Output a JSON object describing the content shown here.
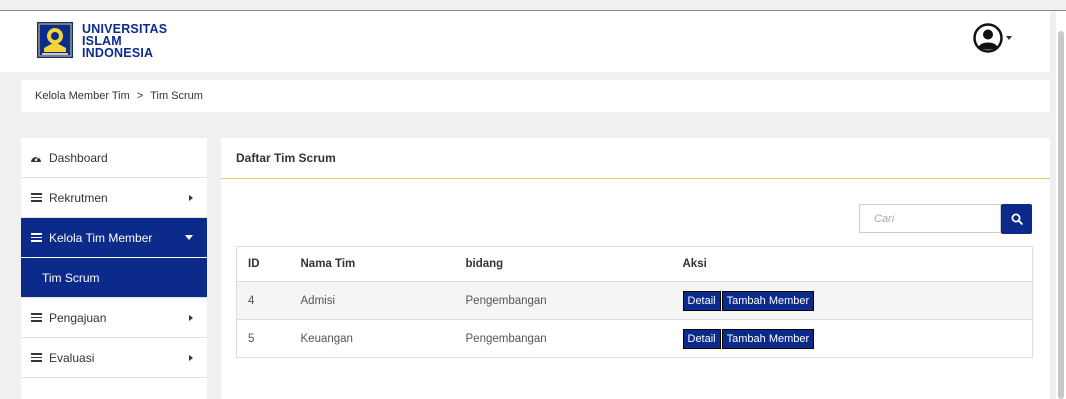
{
  "header": {
    "logo_line1": "UNIVERSITAS",
    "logo_line2": "ISLAM",
    "logo_line3": "INDONESIA"
  },
  "breadcrumb": {
    "parent": "Kelola Member Tim",
    "separator": ">",
    "current": "Tim Scrum"
  },
  "sidebar": {
    "items": [
      {
        "label": "Dashboard",
        "icon": "tachometer-icon"
      },
      {
        "label": "Rekrutmen",
        "icon": "list-icon"
      },
      {
        "label": "Kelola Tim Member",
        "icon": "list-icon"
      },
      {
        "label": "Tim Scrum"
      },
      {
        "label": "Pengajuan",
        "icon": "list-icon"
      },
      {
        "label": "Evaluasi",
        "icon": "list-icon"
      }
    ]
  },
  "panel": {
    "title": "Daftar Tim Scrum",
    "search_placeholder": "Cari"
  },
  "table": {
    "headers": [
      "ID",
      "Nama Tim",
      "bidang",
      "Aksi"
    ],
    "rows": [
      {
        "id": "4",
        "nama": "Admisi",
        "bidang": "Pengembangan"
      },
      {
        "id": "5",
        "nama": "Keuangan",
        "bidang": "Pengembangan"
      }
    ],
    "detail_label": "Detail",
    "tambah_label": "Tambah Member"
  },
  "colors": {
    "accent": "#0b2a8a",
    "brand": "#0a2c8f",
    "header_underline": "#e8c84a"
  }
}
